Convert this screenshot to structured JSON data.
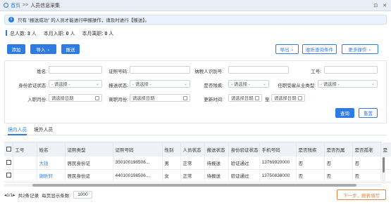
{
  "breadcrumb": {
    "home": "首页",
    "separator": ">>",
    "current": "人员信息采集"
  },
  "window": {
    "restore": "⊡",
    "close": "✕"
  },
  "notice": {
    "text": "只有 \"报送成功\" 的人员才能进行申报操作，请及时进行【报送】。"
  },
  "stats": {
    "total_label": "总人数:",
    "total_value": "3",
    "total_unit": "人",
    "join_label": "本月入职:",
    "join_value": "0",
    "join_unit": "人",
    "leave_label": "本月离职:",
    "leave_value": "0",
    "leave_unit": "人"
  },
  "toolbar": {
    "add": "添加",
    "import": "导入",
    "report": "报送",
    "export": "导出",
    "collapse": "收折查询条件",
    "more": "更多操作"
  },
  "filters": {
    "name_label": "姓名:",
    "idno_label": "证照号码:",
    "taxid_label": "纳税人识别号:",
    "empno_label": "工号:",
    "idverify_label": "身份验证状态:",
    "idverify_value": "- 请选择 -",
    "reportstate_label": "报送状态:",
    "reportstate_value": "- 请选择 -",
    "disabled_label": "是否残疾:",
    "disabled_value": "- 请选择 -",
    "employed_label": "任职受雇从业类型:",
    "employed_value": "- 请选择 -",
    "joindate_label": "入职月份:",
    "joindate_value": "请选择日期",
    "leavedate_label": "离职月份:",
    "leavedate_value": "请选择日期",
    "updatetime_label": "更新时间:",
    "update_from": "请选择日期",
    "update_to_label": "至",
    "update_to": "请选择日期",
    "search": "查询",
    "reset": "重置"
  },
  "tabs": {
    "domestic": "境内人员",
    "foreign": "境外人员"
  },
  "table": {
    "headers": [
      "工号",
      "姓名",
      "证照类型",
      "证照号码",
      "性别",
      "人员状态",
      "报送状态",
      "身份验证状态",
      "手机号码",
      "是否残疾",
      "是否烈属",
      "是否孤老",
      "是"
    ],
    "rows": [
      {
        "empno": "",
        "name": "大钱",
        "idtype": "居民身份证",
        "idno": "350100198506...",
        "gender": "男",
        "status": "正常",
        "report": "待报送",
        "verify": "验证通过",
        "phone": "13769920000",
        "disabled": "否",
        "martyr": "否",
        "elderly": "否"
      },
      {
        "empno": "",
        "name": "谢昕轩",
        "idtype": "居民身份证",
        "idno": "440100198506...",
        "gender": "女",
        "status": "正常",
        "report": "待报送",
        "verify": "验证通过",
        "phone": "13750838000",
        "disabled": "否",
        "martyr": "否",
        "elderly": "否"
      }
    ]
  },
  "pager": {
    "nav": "◂1/1▸",
    "total": "共2条记录",
    "perpage_label": "每页显示条数",
    "perpage": "1000"
  },
  "next_button": "下一步，报表填写",
  "colors": {
    "primary": "#2e7be4",
    "accent": "#e8853a"
  }
}
